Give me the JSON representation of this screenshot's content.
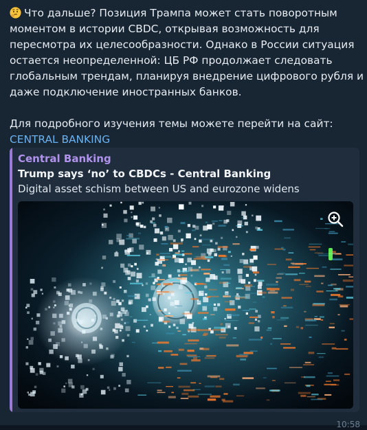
{
  "message": {
    "emoji_icon": "thinking-face-icon",
    "paragraph_lines": [
      "Что дальше? Позиция Трампа может стать поворотным",
      "моментом в истории CBDC, открывая возможность для",
      "пересмотра их целесообразности. Однако в России ситуация",
      "остается неопределенной: ЦБ РФ продолжает следовать",
      "глобальным трендам, планируя внедрение цифрового рубля и",
      "даже подключение иностранных банков."
    ],
    "more_text": "Для подробного изучения темы можете перейти на сайт:",
    "link_text": "CENTRAL BANKING",
    "time": "10:58"
  },
  "link_preview": {
    "site_name": "Central Banking",
    "title": "Trump says ‘no’ to CBDCs - Central Banking",
    "description": "Digital asset schism between US and eurozone widens",
    "zoom_icon": "zoom-in-icon"
  },
  "colors": {
    "background": "#182533",
    "text": "#e6ecf2",
    "link": "#6ab3f3",
    "preview_accent": "#9a7bd8",
    "preview_site": "#b193ee",
    "preview_background": "#1f2d3d"
  }
}
